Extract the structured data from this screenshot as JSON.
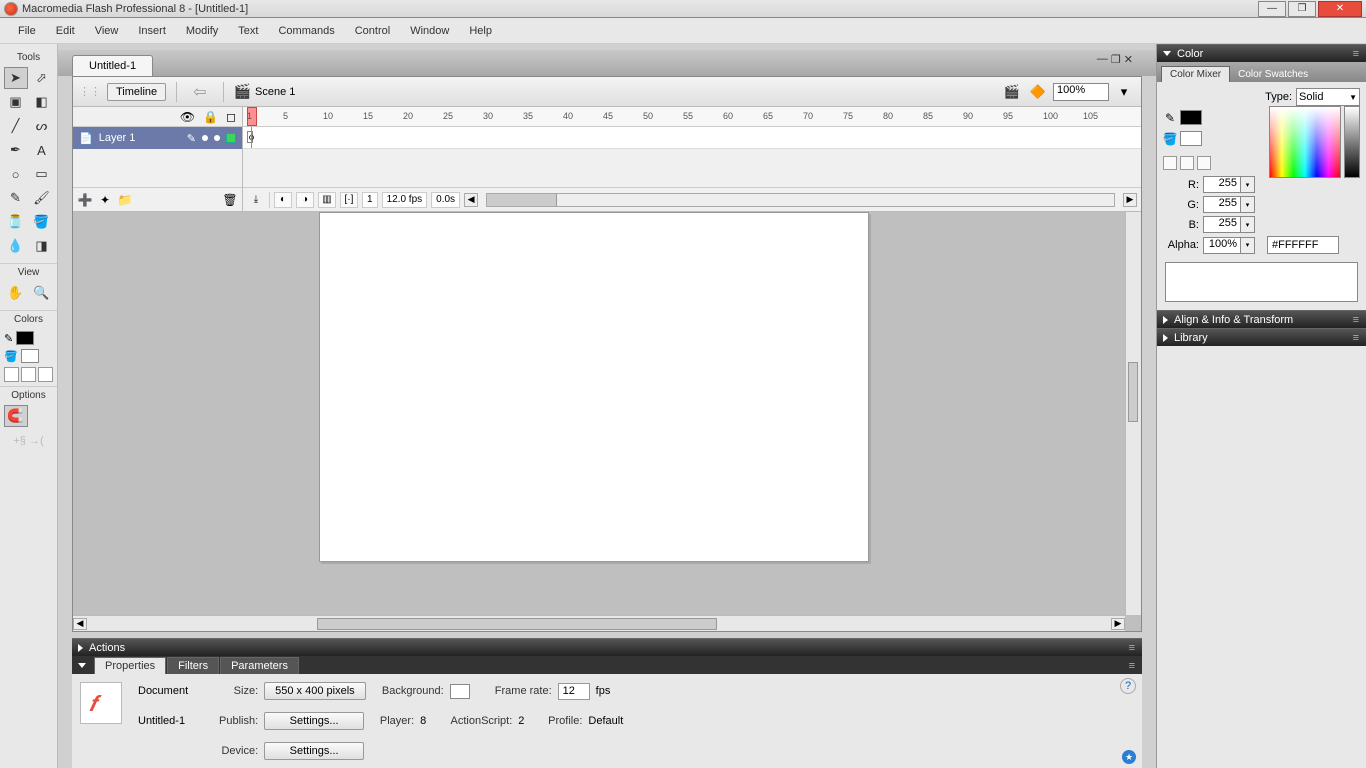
{
  "title": "Macromedia Flash Professional 8 - [Untitled-1]",
  "menu": [
    "File",
    "Edit",
    "View",
    "Insert",
    "Modify",
    "Text",
    "Commands",
    "Control",
    "Window",
    "Help"
  ],
  "tools": {
    "title": "Tools",
    "view_title": "View",
    "colors_title": "Colors",
    "options_title": "Options"
  },
  "doc": {
    "tab": "Untitled-1",
    "timeline_btn": "Timeline",
    "scene": "Scene 1",
    "zoom": "100%"
  },
  "timeline": {
    "layer": "Layer 1",
    "ticks": [
      "1",
      "5",
      "10",
      "15",
      "20",
      "25",
      "30",
      "35",
      "40",
      "45",
      "50",
      "55",
      "60",
      "65",
      "70",
      "75",
      "80",
      "85",
      "90",
      "95",
      "100",
      "105"
    ],
    "cur_frame": "1",
    "fps": "12.0 fps",
    "elapsed": "0.0s"
  },
  "actions_panel": "Actions",
  "props": {
    "tabs": [
      "Properties",
      "Filters",
      "Parameters"
    ],
    "doc_label": "Document",
    "doc_name": "Untitled-1",
    "size_lbl": "Size:",
    "size_btn": "550 x 400 pixels",
    "bg_lbl": "Background:",
    "fr_lbl": "Frame rate:",
    "fr_val": "12",
    "fps_lbl": "fps",
    "publish_lbl": "Publish:",
    "settings_btn": "Settings...",
    "player_lbl": "Player:",
    "player_val": "8",
    "as_lbl": "ActionScript:",
    "as_val": "2",
    "profile_lbl": "Profile:",
    "profile_val": "Default",
    "device_lbl": "Device:"
  },
  "color_panel": {
    "title": "Color",
    "tabs": [
      "Color Mixer",
      "Color Swatches"
    ],
    "type_lbl": "Type:",
    "type_val": "Solid",
    "r_lbl": "R:",
    "g_lbl": "G:",
    "b_lbl": "B:",
    "alpha_lbl": "Alpha:",
    "r": "255",
    "g": "255",
    "b": "255",
    "alpha": "100%",
    "hex": "#FFFFFF"
  },
  "align_panel": "Align & Info & Transform",
  "library_panel": "Library"
}
